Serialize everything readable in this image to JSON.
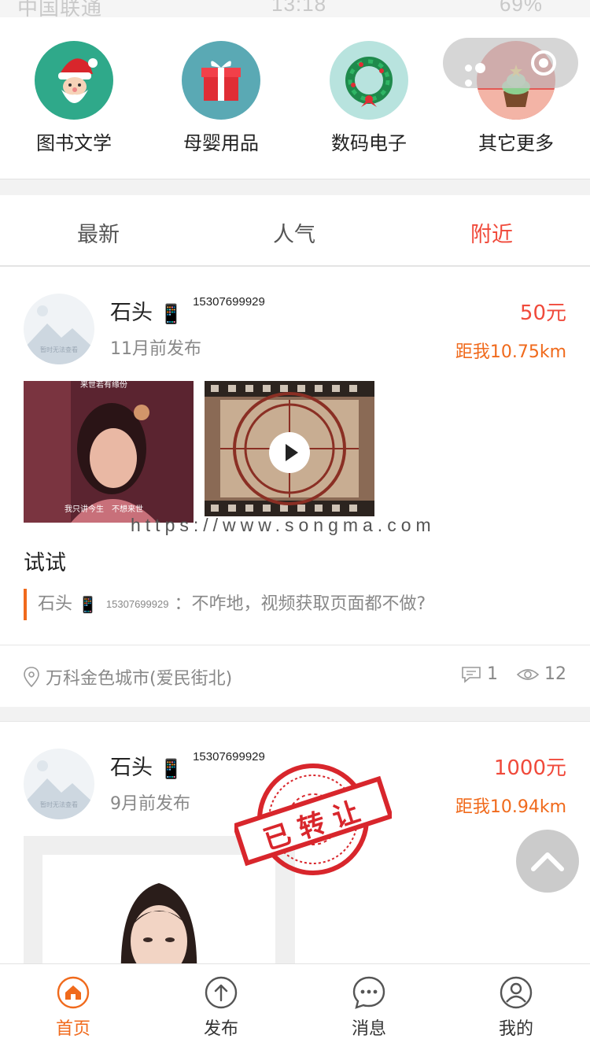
{
  "status_bar": {
    "carrier": "中国联通",
    "time": "13:18",
    "battery": "69%"
  },
  "categories": [
    {
      "label": "图书文学",
      "icon": "santa-icon"
    },
    {
      "label": "母婴用品",
      "icon": "gift-icon"
    },
    {
      "label": "数码电子",
      "icon": "wreath-icon"
    },
    {
      "label": "其它更多",
      "icon": "cupcake-icon"
    }
  ],
  "tabs": [
    {
      "label": "最新",
      "active": false
    },
    {
      "label": "人气",
      "active": false
    },
    {
      "label": "附近",
      "active": true
    }
  ],
  "watermark": "https://www.songma.com",
  "posts": [
    {
      "user": "石头",
      "phone": "15307699929",
      "avatar_caption": "暂时无法查看",
      "posted": "11月前发布",
      "price": "50元",
      "distance": "距我10.75km",
      "image_captions": [
        "来世若有缘份",
        "我只讲今生　不想来世"
      ],
      "title": "试试",
      "reply": {
        "user": "石头",
        "phone": "15307699929",
        "text": "：不咋地，视频获取页面都不做?"
      },
      "location": "万科金色城市(爱民街北)",
      "comments": "1",
      "views": "12"
    },
    {
      "user": "石头",
      "phone": "15307699929",
      "avatar_caption": "暂时无法查看",
      "posted": "9月前发布",
      "price": "1000元",
      "distance": "距我10.94km",
      "stamp": "已转让"
    }
  ],
  "tabbar": [
    {
      "label": "首页",
      "active": true
    },
    {
      "label": "发布",
      "active": false
    },
    {
      "label": "消息",
      "active": false
    },
    {
      "label": "我的",
      "active": false
    }
  ],
  "colors": {
    "accent_red": "#f04a3b",
    "accent_orange": "#f06a1c",
    "stamp_red": "#d8262c"
  }
}
